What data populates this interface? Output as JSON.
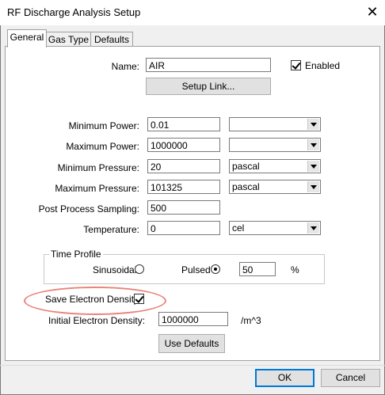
{
  "window": {
    "title": "RF Discharge Analysis Setup"
  },
  "tabs": [
    {
      "label": "General",
      "active": true
    },
    {
      "label": "Gas Type",
      "active": false
    },
    {
      "label": "Defaults",
      "active": false
    }
  ],
  "general": {
    "name_label": "Name:",
    "name_value": "AIR",
    "enabled_label": "Enabled",
    "enabled_checked": true,
    "setup_link_label": "Setup Link...",
    "rows": [
      {
        "label": "Minimum Power:",
        "value": "0.01",
        "unit": ""
      },
      {
        "label": "Maximum Power:",
        "value": "1000000",
        "unit": ""
      },
      {
        "label": "Minimum Pressure:",
        "value": "20",
        "unit": "pascal"
      },
      {
        "label": "Maximum Pressure:",
        "value": "101325",
        "unit": "pascal"
      },
      {
        "label": "Post Process Sampling:",
        "value": "500"
      },
      {
        "label": "Temperature:",
        "value": "0",
        "unit": "cel"
      }
    ],
    "time_profile": {
      "title": "Time Profile",
      "sinusoidal_label": "Sinusoidal",
      "sinusoidal_selected": false,
      "pulsed_label": "Pulsed",
      "pulsed_selected": true,
      "pulsed_value": "50",
      "percent_label": "%"
    },
    "save_density_label": "Save Electron Density",
    "save_density_checked": true,
    "initial_density_label": "Initial Electron Density:",
    "initial_density_value": "1000000",
    "initial_density_unit": "/m^3",
    "use_defaults_label": "Use Defaults"
  },
  "footer": {
    "ok_label": "OK",
    "cancel_label": "Cancel"
  },
  "colors": {
    "highlight": "#e8847c",
    "default_button_border": "#0078d7"
  },
  "icons": {
    "close": "close-icon",
    "checkmark": "checkmark-icon",
    "dropdown": "chevron-down-icon",
    "radio": "radio-dot-icon"
  }
}
